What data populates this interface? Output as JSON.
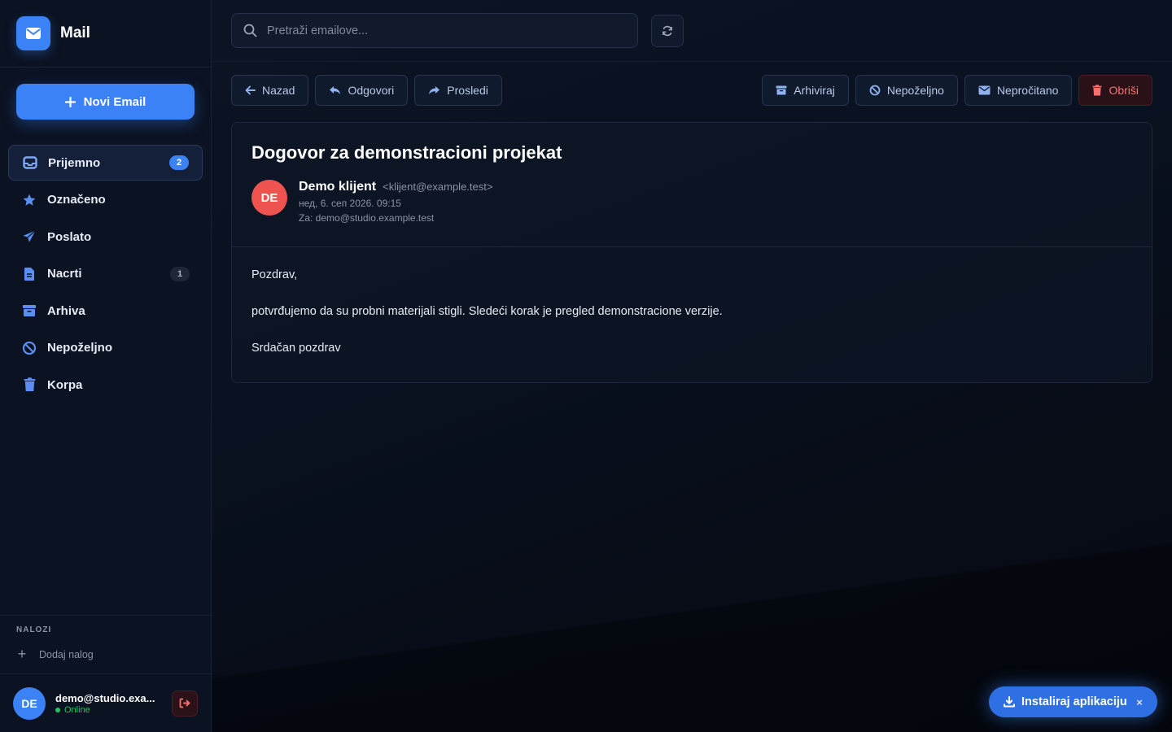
{
  "brand": {
    "name": "Mail",
    "icon": "envelope-icon"
  },
  "compose": {
    "label": "Novi Email",
    "icon": "plus-icon"
  },
  "sidebar": {
    "items": [
      {
        "label": "Prijemno",
        "icon": "inbox-icon",
        "badge": "2",
        "active": true
      },
      {
        "label": "Označeno",
        "icon": "star-icon"
      },
      {
        "label": "Poslato",
        "icon": "paper-plane-icon"
      },
      {
        "label": "Nacrti",
        "icon": "file-icon",
        "badge": "1"
      },
      {
        "label": "Arhiva",
        "icon": "archive-icon"
      },
      {
        "label": "Nepoželjno",
        "icon": "ban-icon"
      },
      {
        "label": "Korpa",
        "icon": "trash-icon"
      }
    ]
  },
  "accounts": {
    "title": "NALOZI",
    "add_label": "Dodaj nalog"
  },
  "user": {
    "initials": "DE",
    "email": "demo@studio.exa...",
    "status": "Online"
  },
  "search": {
    "placeholder": "Pretraži emailove..."
  },
  "toolbar": {
    "left": [
      {
        "label": "Nazad",
        "icon": "arrow-left-icon"
      },
      {
        "label": "Odgovori",
        "icon": "reply-icon"
      },
      {
        "label": "Prosledi",
        "icon": "forward-icon"
      }
    ],
    "right": [
      {
        "label": "Arhiviraj",
        "icon": "archive-icon"
      },
      {
        "label": "Nepoželjno",
        "icon": "ban-icon"
      },
      {
        "label": "Nepročitano",
        "icon": "envelope-icon"
      },
      {
        "label": "Obriši",
        "icon": "trash-icon"
      }
    ]
  },
  "email": {
    "subject": "Dogovor za demonstracioni projekat",
    "sender_initials": "DE",
    "sender_name": "Demo klijent",
    "sender_email": "<klijent@example.test>",
    "date": "нед, 6. сеп 2026. 09:15",
    "recipient": "Za: demo@studio.example.test",
    "body": [
      "Pozdrav,",
      "potvrđujemo da su probni materijali stigli. Sledeći korak je pregled demonstracione verzije.",
      "Srdačan pozdrav"
    ]
  },
  "install": {
    "label": "Instaliraj aplikaciju",
    "close": "×"
  },
  "colors": {
    "accent": "#3b82f6",
    "danger": "#f87171",
    "online": "#22c55e",
    "avatar_sender": "#ef5350"
  }
}
